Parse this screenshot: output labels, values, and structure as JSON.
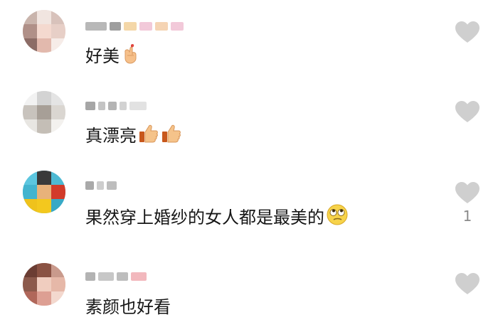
{
  "comments": [
    {
      "text": "好美",
      "emoji": "finger-heart-emoji",
      "likes": ""
    },
    {
      "text": "真漂亮",
      "emoji": "thumbs-up-emoji",
      "likes": ""
    },
    {
      "text": "果然穿上婚纱的女人都是最美的",
      "emoji": "rolling-eyes-emoji",
      "likes": "1"
    },
    {
      "text": "素颜也好看",
      "emoji": "",
      "likes": ""
    }
  ],
  "colors": {
    "like_icon": "#cfcfcf",
    "text": "#161616",
    "count": "#8a8a8a"
  }
}
